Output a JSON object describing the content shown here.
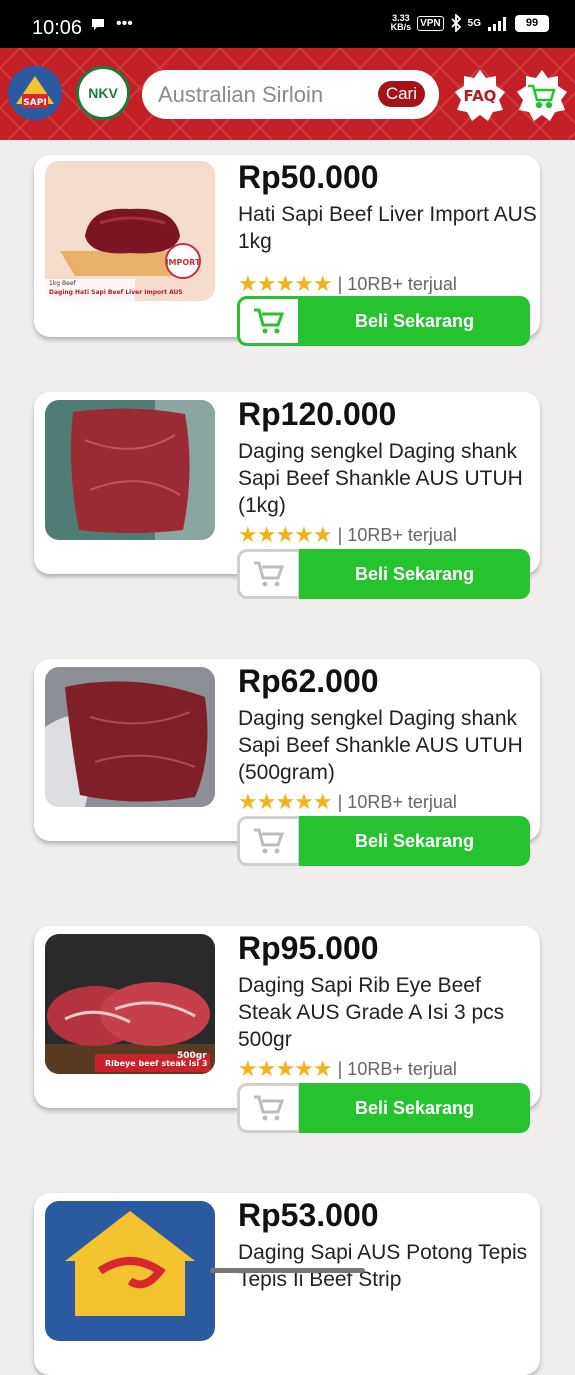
{
  "status": {
    "time": "10:06",
    "net_speed_value": "3.33",
    "net_speed_unit": "KB/s",
    "vpn": "VPN",
    "network": "5G",
    "battery": "99"
  },
  "header": {
    "logo_alt": "logo",
    "nkv": "NKV",
    "search_value": "Australian Sirloin",
    "search_button": "Cari",
    "faq": "FAQ"
  },
  "products": [
    {
      "price": "Rp50.000",
      "title": "Hati Sapi Beef Liver Import AUS 1kg",
      "sold": "| 10RB+ terjual",
      "buy": "Beli Sekarang",
      "stars": "★★★★★",
      "thumb_label": "Daging Hati Sapi Beef Liver Import AUS",
      "thumb_tag": "1kg Beef",
      "thumb_stamp": "IMPORT"
    },
    {
      "price": "Rp120.000",
      "title": "Daging sengkel Daging shank Sapi Beef Shankle AUS UTUH (1kg)",
      "sold": "| 10RB+ terjual",
      "buy": "Beli Sekarang",
      "stars": "★★★★★"
    },
    {
      "price": "Rp62.000",
      "title": "Daging sengkel Daging shank Sapi Beef Shankle AUS UTUH (500gram)",
      "sold": "| 10RB+ terjual",
      "buy": "Beli Sekarang",
      "stars": "★★★★★"
    },
    {
      "price": "Rp95.000",
      "title": "Daging Sapi Rib Eye Beef Steak AUS Grade A Isi 3 pcs 500gr",
      "sold": "| 10RB+ terjual",
      "buy": "Beli Sekarang",
      "stars": "★★★★★",
      "thumb_label": "Ribeye beef steak isi 3",
      "thumb_weight": "500gr"
    },
    {
      "price": "Rp53.000",
      "title": "Daging Sapi AUS Potong Tepis Tepis Ii Beef Strip"
    }
  ]
}
